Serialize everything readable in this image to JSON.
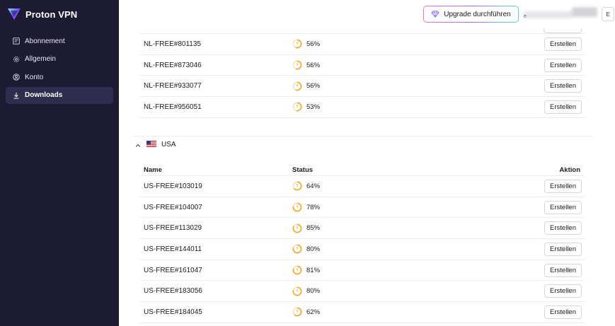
{
  "app": {
    "logo_text": "Proton VPN"
  },
  "sidebar": {
    "items": [
      {
        "label": "Abonnement",
        "icon": "subscription-icon",
        "active": false
      },
      {
        "label": "Allgemein",
        "icon": "gear-icon",
        "active": false
      },
      {
        "label": "Konto",
        "icon": "user-icon",
        "active": false
      },
      {
        "label": "Downloads",
        "icon": "download-icon",
        "active": true
      }
    ]
  },
  "header": {
    "upgrade_label": "Upgrade durchführen",
    "account_email_fragment": "e",
    "avatar_initial": "E"
  },
  "colors": {
    "sidebar_bg": "#1c1b33",
    "active_bg": "#2e2d4d",
    "gauge_orange": "#f5a623",
    "brand_purple": "#6d4aff"
  },
  "sections": {
    "nl": {
      "rows": [
        {
          "name": "NL-FREE#801135",
          "load": "56%",
          "load_value": 56,
          "action": "Erstellen"
        },
        {
          "name": "NL-FREE#873046",
          "load": "56%",
          "load_value": 56,
          "action": "Erstellen"
        },
        {
          "name": "NL-FREE#933077",
          "load": "56%",
          "load_value": 56,
          "action": "Erstellen"
        },
        {
          "name": "NL-FREE#956051",
          "load": "53%",
          "load_value": 53,
          "action": "Erstellen"
        }
      ]
    },
    "usa": {
      "country": "USA",
      "columns": {
        "name": "Name",
        "status": "Status",
        "action": "Aktion"
      },
      "rows": [
        {
          "name": "US-FREE#103019",
          "load": "64%",
          "load_value": 64,
          "action": "Erstellen"
        },
        {
          "name": "US-FREE#104007",
          "load": "78%",
          "load_value": 78,
          "action": "Erstellen"
        },
        {
          "name": "US-FREE#113029",
          "load": "85%",
          "load_value": 85,
          "action": "Erstellen"
        },
        {
          "name": "US-FREE#144011",
          "load": "80%",
          "load_value": 80,
          "action": "Erstellen"
        },
        {
          "name": "US-FREE#161047",
          "load": "81%",
          "load_value": 81,
          "action": "Erstellen"
        },
        {
          "name": "US-FREE#183056",
          "load": "80%",
          "load_value": 80,
          "action": "Erstellen"
        },
        {
          "name": "US-FREE#184045",
          "load": "62%",
          "load_value": 62,
          "action": "Erstellen"
        }
      ]
    }
  }
}
